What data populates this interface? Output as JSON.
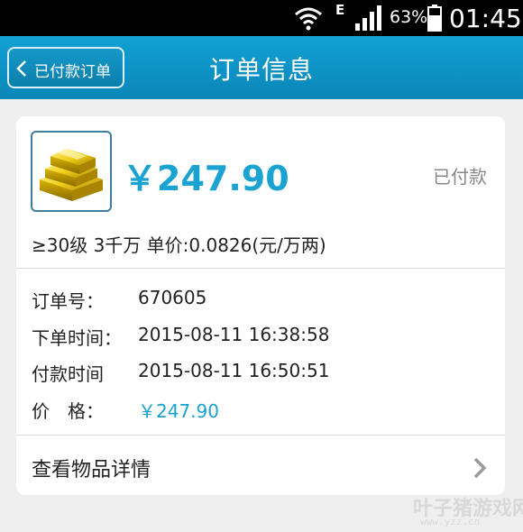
{
  "status_bar": {
    "network_type": "E",
    "battery_percent": "63%",
    "time": "01:45",
    "icons": [
      "wifi-icon",
      "signal-icon",
      "battery-icon"
    ]
  },
  "header": {
    "back_label": "已付款订单",
    "title": "订单信息"
  },
  "order": {
    "item_icon": "gold-bars-icon",
    "price_display": "￥247.90",
    "status": "已付款",
    "description": "≥30级 3千万 单价:0.0826(元/万两)",
    "fields": [
      {
        "label": "订单号：",
        "value": "670605"
      },
      {
        "label": "下单时间：",
        "value": "2015-08-11 16:38:58"
      },
      {
        "label": "付款时间",
        "value": "2015-08-11 16:50:51"
      },
      {
        "label": "价　格：",
        "value": "￥247.90"
      }
    ],
    "details_link": "查看物品详情"
  },
  "watermark": {
    "logo": "叶子猪游戏网",
    "url": "www.yzz.cn"
  },
  "colors": {
    "accent": "#1aa3d2",
    "header": "#0a86b7",
    "background": "#efefef"
  }
}
